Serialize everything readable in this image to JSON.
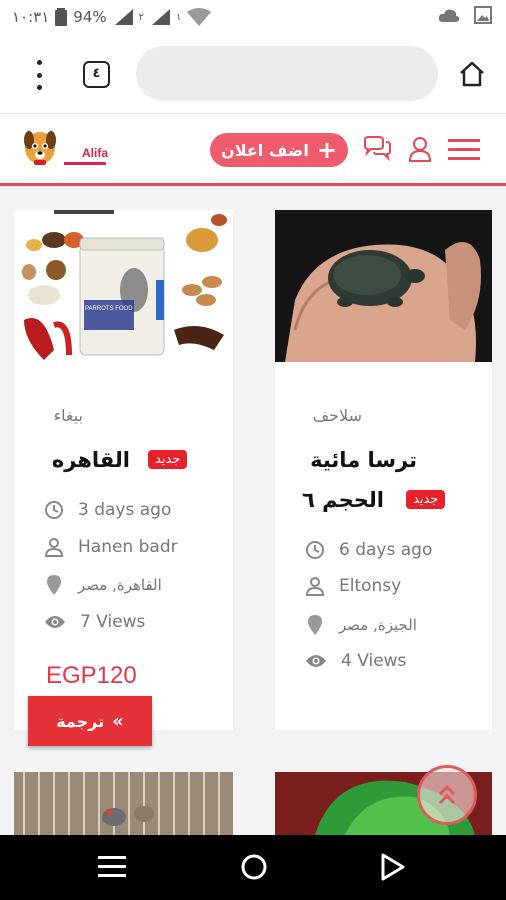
{
  "status_bar": {
    "time": "١٠:٣١",
    "battery": "94%",
    "sim1_label": "١",
    "sim2_label": "٢"
  },
  "browser": {
    "tab_count": "٤",
    "url": ""
  },
  "header": {
    "logo_text": "Alifa",
    "add_ad_label": "اضف اعلان"
  },
  "listings": [
    {
      "category": "سلاحف",
      "title_line1": "ترسا مائية",
      "title_line2": "الحجم ٦",
      "badge": "جديد",
      "time": "6 days ago",
      "author": "Eltonsy",
      "location": "الجيزة, مصر",
      "views": "4 Views",
      "price": ""
    },
    {
      "category": "بيغاء",
      "title_line1": "القاهره",
      "badge": "جديد",
      "time": "3 days ago",
      "author": "Hanen badr",
      "location": "القاهرة, مصر",
      "views": "7 Views",
      "price": "EGP120",
      "image_text": "PARROTS FOOD"
    }
  ],
  "translate_button": "ترجمة",
  "colors": {
    "accent": "#ef5c6e",
    "badge": "#e8202a",
    "price": "#e3374a"
  }
}
